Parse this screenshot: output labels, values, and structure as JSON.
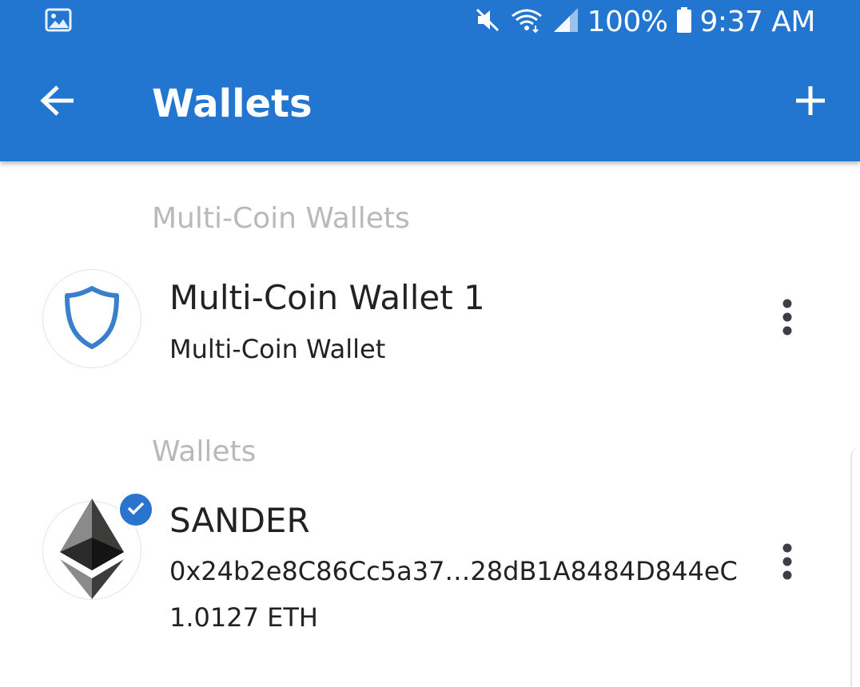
{
  "status_bar": {
    "battery": "100%",
    "time": "9:37 AM",
    "icons": [
      "gallery-icon",
      "mute-icon",
      "wifi-icon",
      "signal-icon",
      "battery-icon"
    ]
  },
  "app_bar": {
    "title": "Wallets",
    "back_icon": "arrow-left-icon",
    "add_icon": "plus-icon",
    "background": "#2276d0"
  },
  "sections": {
    "multi_coin": {
      "header": "Multi-Coin Wallets",
      "wallet": {
        "name": "Multi-Coin Wallet 1",
        "type": "Multi-Coin Wallet",
        "icon": "shield-icon",
        "menu_icon": "more-vertical-icon"
      }
    },
    "wallets": {
      "header": "Wallets",
      "wallet": {
        "name": "SANDER",
        "address": "0x24b2e8C86Cc5a37…28dB1A8484D844eC",
        "balance": "1.0127 ETH",
        "icon": "ethereum-icon",
        "selected": true,
        "selected_icon": "checkmark-icon",
        "menu_icon": "more-vertical-icon"
      }
    }
  },
  "colors": {
    "accent": "#2276d0",
    "section_header": "#b9b9b9",
    "text": "#222222"
  }
}
